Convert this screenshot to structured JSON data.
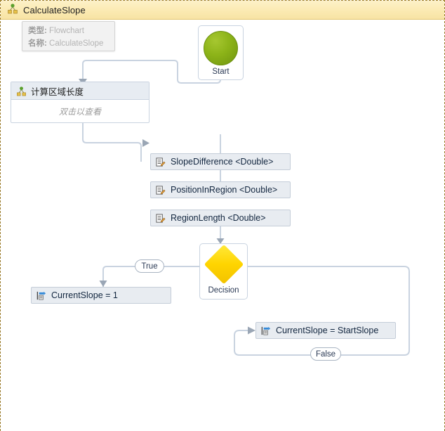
{
  "header": {
    "title": "CalculateSlope",
    "icon": "flowchart-icon"
  },
  "tooltip": {
    "type_key": "类型:",
    "type_value": "Flowchart",
    "name_key": "名称:",
    "name_value": "CalculateSlope"
  },
  "canvas": {
    "background": "#ffffff",
    "border_color": "#9a7b2a"
  },
  "nodes": {
    "start": {
      "label": "Start",
      "icon": "start-circle-icon",
      "color": "#8cb318"
    },
    "sub_flowchart": {
      "title": "计算区域长度",
      "hint": "双击以查看",
      "icon": "flowchart-icon"
    },
    "slope_difference": {
      "label": "SlopeDifference <Double>",
      "icon": "variable-assign-icon"
    },
    "position_in_region": {
      "label": "PositionInRegion <Double>",
      "icon": "variable-assign-icon"
    },
    "region_length": {
      "label": "RegionLength <Double>",
      "icon": "variable-assign-icon"
    },
    "decision": {
      "label": "Decision",
      "icon": "decision-diamond-icon",
      "color": "#ffd400"
    },
    "current_slope_one": {
      "label": "CurrentSlope = 1",
      "icon": "assign-icon"
    },
    "current_slope_start": {
      "label": "CurrentSlope = StartSlope",
      "icon": "assign-icon"
    }
  },
  "connectors": {
    "true_label": "True",
    "false_label": "False",
    "line_color": "#c9d3e0"
  }
}
